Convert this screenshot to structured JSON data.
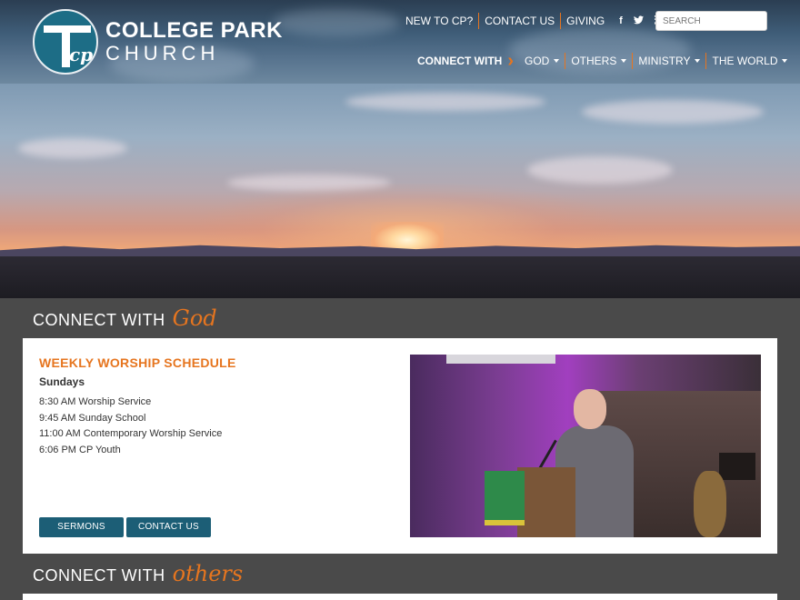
{
  "brand": {
    "line1": "COLLEGE PARK",
    "line2": "CHURCH",
    "mark_letter": "cp"
  },
  "top_links": [
    "NEW TO CP?",
    "CONTACT US",
    "GIVING"
  ],
  "social": {
    "facebook": "f",
    "twitter": "t",
    "rss": "rss"
  },
  "search": {
    "placeholder": "SEARCH"
  },
  "main_nav": {
    "lead": "CONNECT WITH",
    "items": [
      "GOD",
      "OTHERS",
      "MINISTRY",
      "THE WORLD"
    ]
  },
  "section1": {
    "plain": "CONNECT WITH",
    "script": "God"
  },
  "worship": {
    "heading": "WEEKLY WORSHIP SCHEDULE",
    "day": "Sundays",
    "items": [
      "8:30 AM Worship Service",
      "9:45 AM Sunday School",
      "11:00 AM Contemporary Worship Service",
      "6:06 PM CP Youth"
    ],
    "buttons": [
      "SERMONS",
      "CONTACT US"
    ]
  },
  "section2": {
    "plain": "CONNECT WITH",
    "script": "others"
  },
  "colors": {
    "accent": "#e6751f",
    "brand": "#1c5e76",
    "background": "#4a4a4a"
  }
}
